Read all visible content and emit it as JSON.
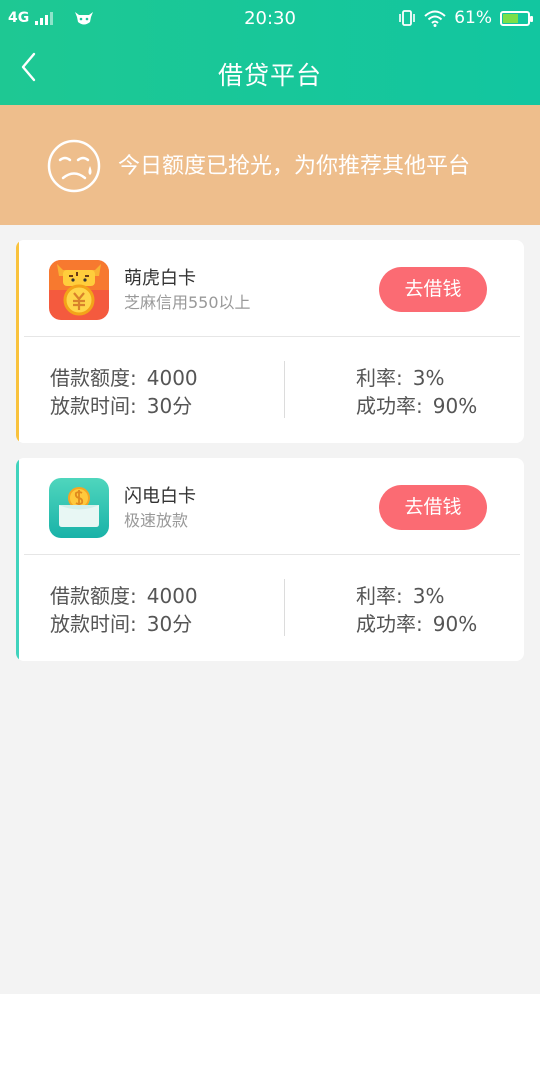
{
  "status_bar": {
    "network": "4G",
    "time": "20:30",
    "battery_percent": "61%",
    "battery_level": 0.61
  },
  "nav": {
    "title": "借贷平台",
    "back_icon": "chevron-left-icon"
  },
  "banner": {
    "icon": "sad-face-icon",
    "text": "今日额度已抢光，为你推荐其他平台"
  },
  "colors": {
    "header": "#16c69a",
    "banner": "#eebe8c",
    "button": "#fb6b73",
    "card1_accent": "#f9c23c",
    "card2_accent": "#40d3bd"
  },
  "cards": [
    {
      "name": "萌虎白卡",
      "subtitle": "芝麻信用550以上",
      "button": "去借钱",
      "amount_label": "借款额度:",
      "amount": "4000",
      "time_label": "放款时间:",
      "time": "30分",
      "rate_label": "利率:",
      "rate": "3%",
      "success_label": "成功率:",
      "success": "90%"
    },
    {
      "name": "闪电白卡",
      "subtitle": "极速放款",
      "button": "去借钱",
      "amount_label": "借款额度:",
      "amount": "4000",
      "time_label": "放款时间:",
      "time": "30分",
      "rate_label": "利率:",
      "rate": "3%",
      "success_label": "成功率:",
      "success": "90%"
    }
  ]
}
